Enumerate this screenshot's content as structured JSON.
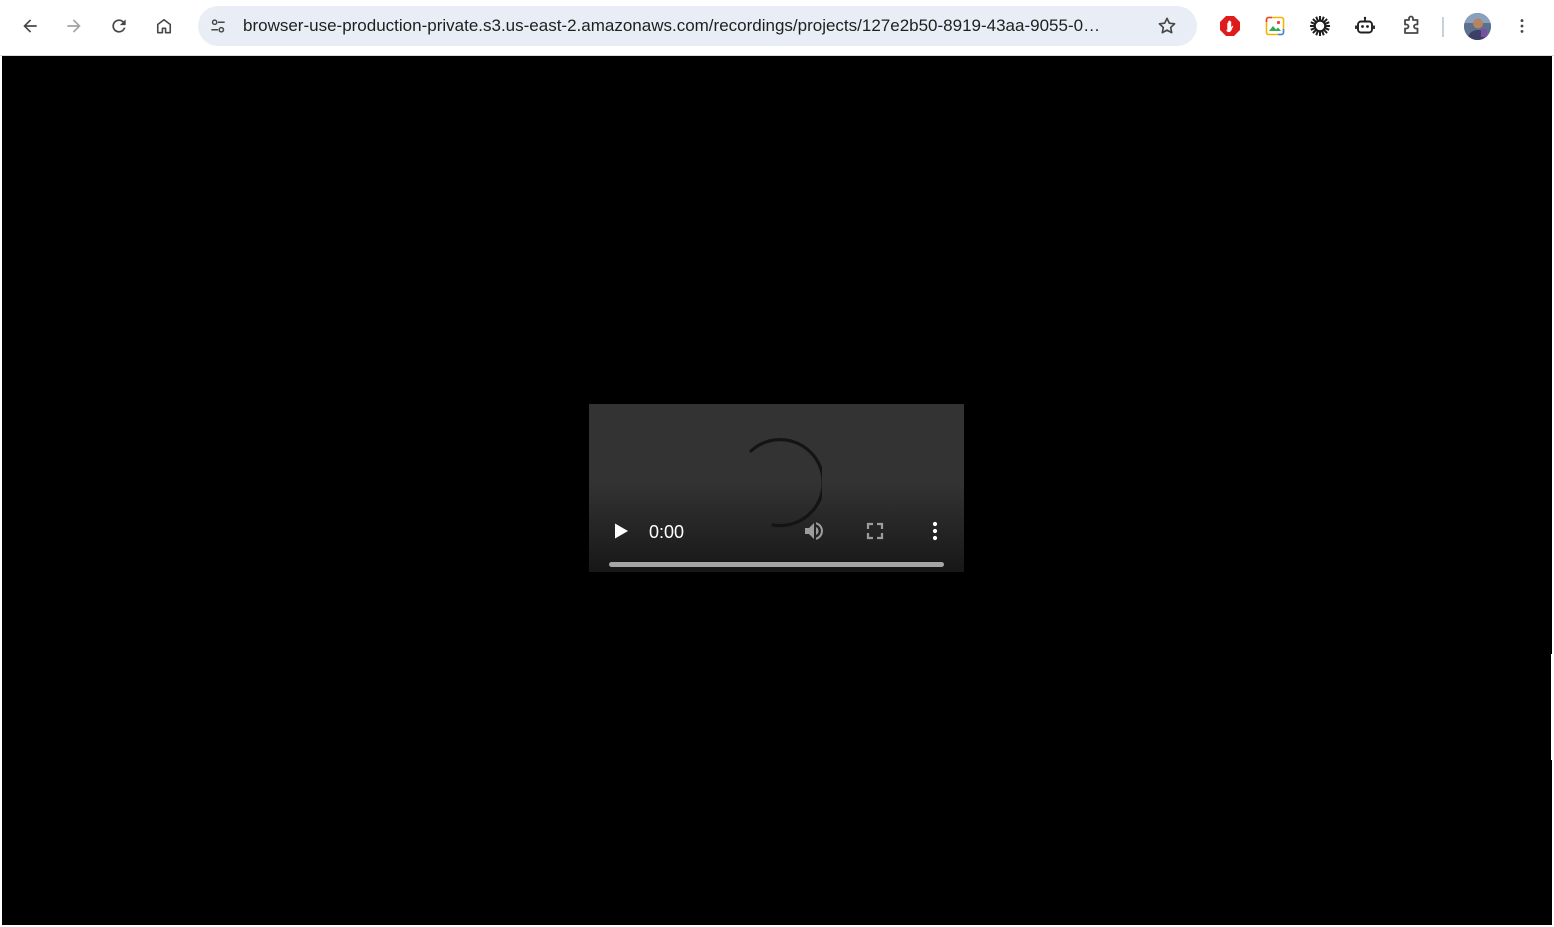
{
  "browser": {
    "url": "browser-use-production-private.s3.us-east-2.amazonaws.com/recordings/projects/127e2b50-8919-43aa-9055-0…",
    "icons": {
      "back": "arrow-left-icon",
      "forward": "arrow-right-icon",
      "reload": "reload-icon",
      "home": "home-icon",
      "site_info": "tune-icon",
      "bookmark": "star-icon",
      "extension_1": "adblock-icon",
      "extension_2": "image-extension-icon",
      "extension_3": "sun-gear-icon",
      "extension_4": "robot-icon",
      "extensions": "puzzle-icon",
      "menu": "kebab-menu-icon"
    }
  },
  "video_player": {
    "current_time": "0:00",
    "state": "loading",
    "progress": 0,
    "icons": {
      "play": "play-icon",
      "volume": "volume-icon",
      "fullscreen": "fullscreen-icon",
      "more": "more-vertical-icon",
      "spinner": "loading-spinner-icon"
    }
  },
  "colors": {
    "toolbar_bg": "#ffffff",
    "omnibox_bg": "#e9eef6",
    "page_bg": "#000000",
    "video_bg": "#333333",
    "adblock_red": "#e01b1b"
  }
}
